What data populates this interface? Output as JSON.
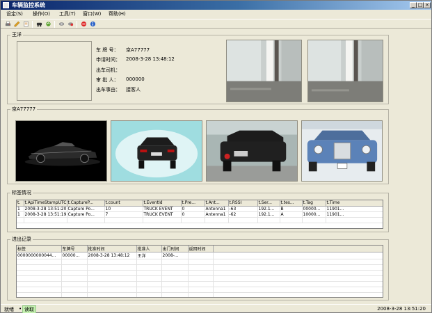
{
  "window": {
    "title": "车辆监控系统"
  },
  "menu": [
    "设定(S)",
    "操作(O)",
    "工具(T)",
    "窗口(W)",
    "帮助(H)"
  ],
  "toolbar_icons": [
    "print-icon",
    "edit-icon",
    "document-icon",
    "vehicle-icon",
    "refresh-icon",
    "link-icon",
    "disconnect-icon",
    "stop-icon",
    "help-icon"
  ],
  "driver": {
    "group_label": "王洋",
    "fields": [
      {
        "label": "车 牌 号：",
        "value": "京A77777"
      },
      {
        "label": "申请时间：",
        "value": "2008-3-28 13:48:12"
      },
      {
        "label": "出车司机：",
        "value": ""
      },
      {
        "label": "审 批 人：",
        "value": "000000"
      },
      {
        "label": "出车事由：",
        "value": "接客人"
      }
    ]
  },
  "vehicle_photos": {
    "group_label": "京A77777"
  },
  "tag_status": {
    "group_label": "标签情况",
    "columns": [
      "t.",
      "t.ApiTimeStampUTC",
      "t.CaptureP...",
      "t.count",
      "t.EventId",
      "t.Pre...",
      "t.Ant...",
      "t.RSSI",
      "t.Ser...",
      "t.tes...",
      "t.Tag",
      "t.Time"
    ],
    "rows": [
      [
        "1",
        "2008-3-28 13:51:20",
        "Capture Po...",
        "10",
        "TRUCK EVENT",
        "0",
        "Antenna1",
        "-63",
        "192.1...",
        "B",
        "00000...",
        "11901..."
      ],
      [
        "1",
        "2008-3-28 13:51:19",
        "Capture Po...",
        "7",
        "TRUCK EVENT",
        "0",
        "Antenna1",
        "-62",
        "192.1...",
        "A",
        "10000...",
        "11901..."
      ]
    ]
  },
  "inout_records": {
    "group_label": "进出记录",
    "columns": [
      "标签",
      "车牌号",
      "批准时间",
      "批准人",
      "出门时间",
      "返回时间"
    ],
    "rows": [
      [
        "0000000000044...",
        "00000...",
        "2008-3-28 13:48:12",
        "王洋",
        "2008-...",
        ""
      ]
    ]
  },
  "status": {
    "left": "就绪",
    "dot": "•",
    "reading": "读取",
    "time": "2008-3-28 13:51:20"
  }
}
